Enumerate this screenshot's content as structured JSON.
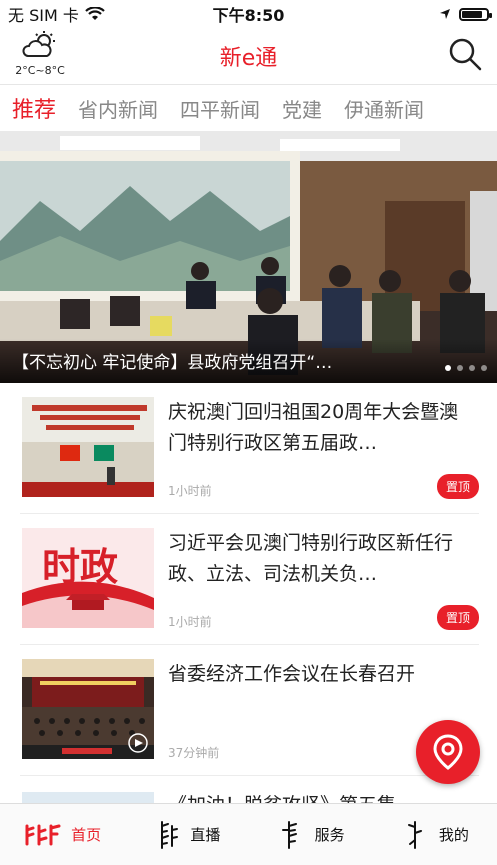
{
  "status_bar": {
    "carrier": "无 SIM 卡",
    "time": "下午8:50"
  },
  "header": {
    "weather_temp": "2°C~8°C",
    "title": "新e通",
    "weather_icon": "cloudy-sun-icon",
    "search_icon": "search-icon"
  },
  "tabs": [
    {
      "label": "推荐",
      "active": true
    },
    {
      "label": "省内新闻"
    },
    {
      "label": "四平新闻"
    },
    {
      "label": "党建"
    },
    {
      "label": "伊通新闻"
    }
  ],
  "banner": {
    "caption": "【不忘初心 牢记使命】县政府党组召开“…",
    "slides": 4,
    "active_slide": 1
  },
  "news": [
    {
      "title": "庆祝澳门回归祖国20周年大会暨澳门特别行政区第五届政…",
      "time": "1小时前",
      "badge": "置顶"
    },
    {
      "title": "习近平会见澳门特别行政区新任行政、立法、司法机关负…",
      "time": "1小时前",
      "badge": "置顶",
      "thumb_text": "时政"
    },
    {
      "title": "省委经济工作会议在长春召开",
      "time": "37分钟前"
    }
  ],
  "partial_item": {
    "title": "《加油！脱贫攻坚》第五集"
  },
  "tabbar": [
    {
      "label": "首页",
      "active": true
    },
    {
      "label": "直播"
    },
    {
      "label": "服务"
    },
    {
      "label": "我的"
    }
  ],
  "colors": {
    "accent": "#e8202a"
  }
}
